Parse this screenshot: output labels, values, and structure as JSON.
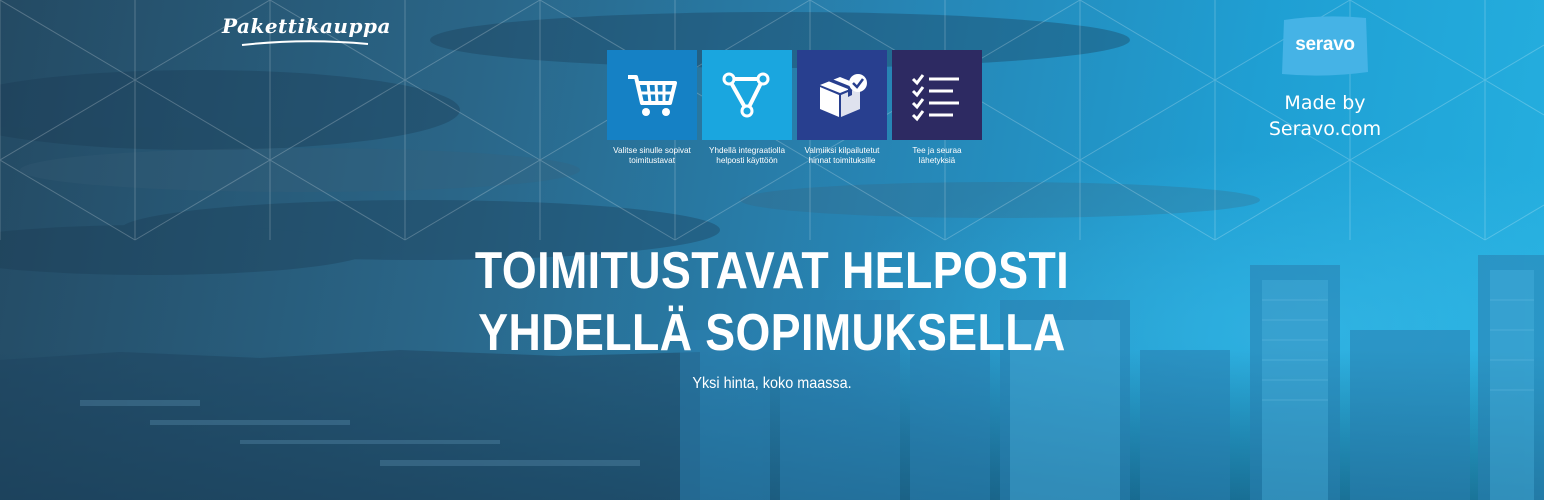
{
  "brand": {
    "logo_text": "Pakettikauppa",
    "partner_logo_text": "seravo",
    "made_by_line1": "Made by",
    "made_by_line2": "Seravo.com"
  },
  "features": [
    {
      "icon": "shopping-cart-icon",
      "color": "#1581c5",
      "caption_line1": "Valitse sinulle sopivat",
      "caption_line2": "toimitustavat"
    },
    {
      "icon": "integration-nodes-icon",
      "color": "#1aa6df",
      "caption_line1": "Yhdellä integraatiolla",
      "caption_line2": "helposti käyttöön"
    },
    {
      "icon": "package-check-icon",
      "color": "#283f8f",
      "caption_line1": "Valmiiksi kilpailutetut",
      "caption_line2": "hinnat toimituksille"
    },
    {
      "icon": "checklist-icon",
      "color": "#2d2a62",
      "caption_line1": "Tee ja seuraa",
      "caption_line2": "lähetyksiä"
    }
  ],
  "hero": {
    "headline_line1": "TOIMITUSTAVAT HELPOSTI",
    "headline_line2": "YHDELLÄ SOPIMUKSELLA",
    "tagline": "Yksi hinta, koko maassa."
  },
  "colors": {
    "partner_badge": "#45b3e6"
  }
}
